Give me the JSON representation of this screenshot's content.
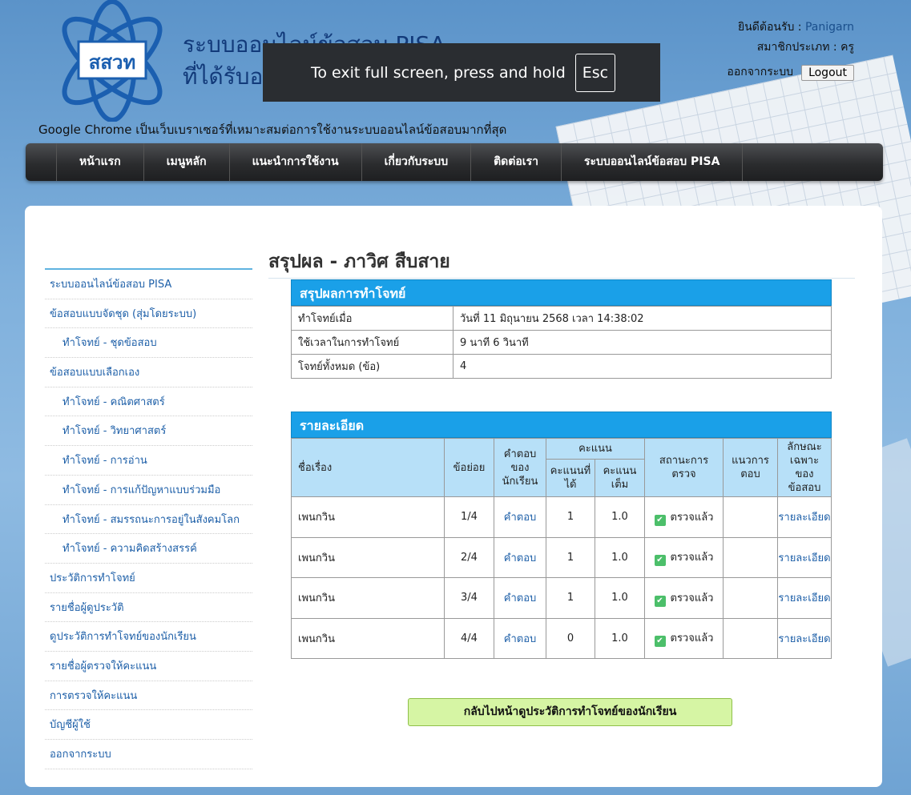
{
  "header": {
    "logo_text": "สสวท",
    "site_title_line1": "ระบบออนไลน์ข้อสอบ PISA",
    "site_title_line2": "ที่ได้รับอ",
    "fullscreen_msg": "To exit full screen, press and hold",
    "fullscreen_key": "Esc",
    "welcome_label": "ยินดีต้อนรับ : ",
    "username": "Panigarn",
    "member_type": "สมาชิกประเภท : ครู",
    "logout_label": "ออกจากระบบ",
    "logout_button": "Logout",
    "browser_note": "Google Chrome เป็นเว็บเบราเซอร์ที่เหมาะสมต่อการใช้งานระบบออนไลน์ข้อสอบมากที่สุด"
  },
  "nav": [
    "หน้าแรก",
    "เมนูหลัก",
    "แนะนำการใช้งาน",
    "เกี่ยวกับระบบ",
    "ติดต่อเรา",
    "ระบบออนไลน์ข้อสอบ PISA"
  ],
  "sidebar": [
    {
      "label": "ระบบออนไลน์ข้อสอบ PISA",
      "sub": false
    },
    {
      "label": "ข้อสอบแบบจัดชุด (สุ่มโดยระบบ)",
      "sub": false
    },
    {
      "label": "ทำโจทย์ - ชุดข้อสอบ",
      "sub": true
    },
    {
      "label": "ข้อสอบแบบเลือกเอง",
      "sub": false
    },
    {
      "label": "ทำโจทย์ - คณิตศาสตร์",
      "sub": true
    },
    {
      "label": "ทำโจทย์ - วิทยาศาสตร์",
      "sub": true
    },
    {
      "label": "ทำโจทย์ - การอ่าน",
      "sub": true
    },
    {
      "label": "ทำโจทย์ - การแก้ปัญหาแบบร่วมมือ",
      "sub": true
    },
    {
      "label": "ทำโจทย์ - สมรรถนะการอยู่ในสังคมโลก",
      "sub": true
    },
    {
      "label": "ทำโจทย์ - ความคิดสร้างสรรค์",
      "sub": true
    },
    {
      "label": "ประวัติการทำโจทย์",
      "sub": false
    },
    {
      "label": "รายชื่อผู้ดูประวัติ",
      "sub": false
    },
    {
      "label": "ดูประวัติการทำโจทย์ของนักเรียน",
      "sub": false
    },
    {
      "label": "รายชื่อผู้ตรวจให้คะแนน",
      "sub": false
    },
    {
      "label": "การตรวจให้คะแนน",
      "sub": false
    },
    {
      "label": "บัญชีผู้ใช้",
      "sub": false
    },
    {
      "label": "ออกจากระบบ",
      "sub": false
    }
  ],
  "main": {
    "page_title": "สรุปผล - ภาวิศ สืบสาย",
    "summary": {
      "caption": "สรุปผลการทำโจทย์",
      "rows": [
        {
          "label": "ทำโจทย์เมื่อ",
          "value": "วันที่ 11 มิถุนายน 2568 เวลา 14:38:02"
        },
        {
          "label": "ใช้เวลาในการทำโจทย์",
          "value": "9 นาที 6 วินาที"
        },
        {
          "label": "โจทย์ทั้งหมด (ข้อ)",
          "value": "4"
        }
      ]
    },
    "detail": {
      "caption": "รายละเอียด",
      "headers": {
        "title": "ชื่อเรื่อง",
        "item": "ข้อย่อย",
        "answer": "คำตอบของนักเรียน",
        "score_group": "คะแนน",
        "score_got": "คะแนนที่ได้",
        "score_full": "คะแนนเต็ม",
        "status": "สถานะการตรวจ",
        "guide": "แนวการตอบ",
        "feature": "ลักษณะเฉพาะของข้อสอบ"
      },
      "rows": [
        {
          "title": "เพนกวิน",
          "item": "1/4",
          "answer": "คำตอบ",
          "got": "1",
          "full": "1.0",
          "status": "ตรวจแล้ว",
          "feature": "รายละเอียด"
        },
        {
          "title": "เพนกวิน",
          "item": "2/4",
          "answer": "คำตอบ",
          "got": "1",
          "full": "1.0",
          "status": "ตรวจแล้ว",
          "feature": "รายละเอียด"
        },
        {
          "title": "เพนกวิน",
          "item": "3/4",
          "answer": "คำตอบ",
          "got": "1",
          "full": "1.0",
          "status": "ตรวจแล้ว",
          "feature": "รายละเอียด"
        },
        {
          "title": "เพนกวิน",
          "item": "4/4",
          "answer": "คำตอบ",
          "got": "0",
          "full": "1.0",
          "status": "ตรวจแล้ว",
          "feature": "รายละเอียด"
        }
      ]
    },
    "back_button": "กลับไปหน้าดูประวัติการทำโจทย์ของนักเรียน"
  }
}
